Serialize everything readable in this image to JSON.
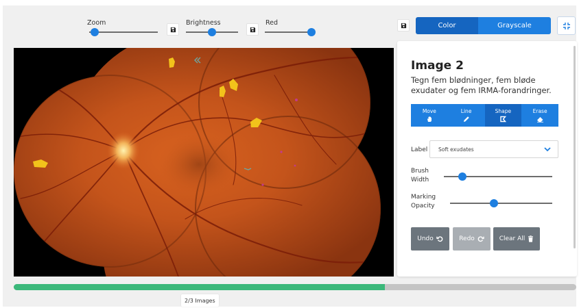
{
  "toolbar": {
    "sliders": [
      {
        "label": "Zoom",
        "value": 0.08
      },
      {
        "label": "Brightness",
        "value": 0.5
      },
      {
        "label": "Red",
        "value": 0.95
      }
    ],
    "color_mode": {
      "options": [
        "Color",
        "Grayscale"
      ],
      "selected": "Color"
    }
  },
  "panel": {
    "title": "Image 2",
    "instructions": "Tegn fem blødninger, fem bløde exudater og fem IRMA-forandringer.",
    "tools": [
      {
        "label": "Move",
        "icon": "hand-icon"
      },
      {
        "label": "Line",
        "icon": "pencil-icon"
      },
      {
        "label": "Shape",
        "icon": "lasso-icon",
        "active": true
      },
      {
        "label": "Erase",
        "icon": "eraser-icon"
      }
    ],
    "label_field": {
      "label": "Label",
      "value": "Soft exudates"
    },
    "brush_width": {
      "label_line1": "Brush",
      "label_line2": "Width",
      "value": 0.17
    },
    "marking_opacity": {
      "label_line1": "Marking",
      "label_line2": "Opacity",
      "value": 0.43
    },
    "buttons": {
      "undo": "Undo",
      "redo": "Redo",
      "clear_all": "Clear All"
    }
  },
  "progress": {
    "current": 2,
    "total": 3,
    "fraction": 0.66,
    "label": "2/3 Images"
  },
  "colors": {
    "accent": "#1e7fe0",
    "accent_active": "#1565c0",
    "progress": "#3bb87a",
    "exudate_marks": "#f2c31b"
  }
}
